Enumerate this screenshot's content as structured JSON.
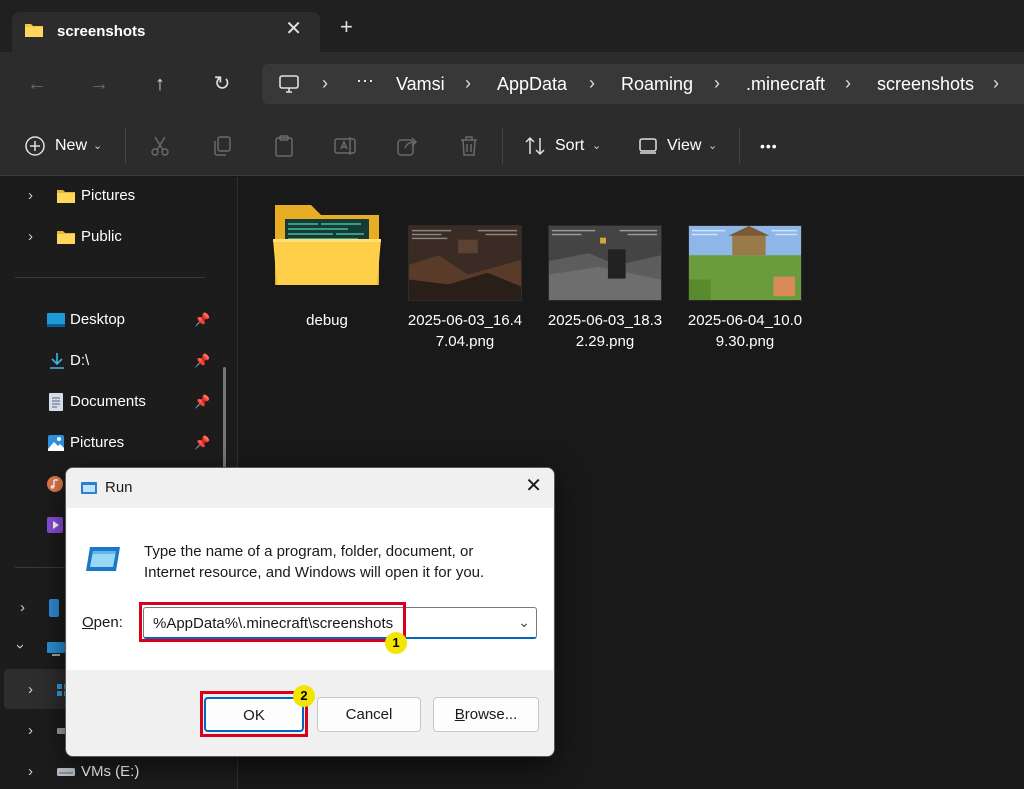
{
  "window": {
    "tab_title": "screenshots",
    "tab_close": "✕",
    "new_tab": "+"
  },
  "address": {
    "back": "←",
    "forward": "→",
    "up": "↑",
    "refresh": "↻",
    "more": "···",
    "breadcrumbs": [
      "Vamsi",
      "AppData",
      "Roaming",
      ".minecraft",
      "screenshots"
    ],
    "separator": "›"
  },
  "toolbar": {
    "new_label": "New",
    "sort_label": "Sort",
    "view_label": "View",
    "more": "•••"
  },
  "sidebar": {
    "items": [
      {
        "label": "Pictures",
        "icon": "folder-icon"
      },
      {
        "label": "Public",
        "icon": "folder-icon"
      },
      {
        "label": "Desktop",
        "icon": "desktop-icon"
      },
      {
        "label": "D:\\",
        "icon": "download-icon"
      },
      {
        "label": "Documents",
        "icon": "documents-icon"
      },
      {
        "label": "Pictures",
        "icon": "pictures-icon"
      },
      {
        "label": "VMs (E:)",
        "icon": "drive-icon"
      }
    ]
  },
  "files": [
    {
      "name": "debug",
      "type": "folder"
    },
    {
      "name": "2025-06-03_16.47.04.png",
      "line1": "2025-06-03_16.4",
      "line2": "7.04.png",
      "type": "image"
    },
    {
      "name": "2025-06-03_18.32.29.png",
      "line1": "2025-06-03_18.3",
      "line2": "2.29.png",
      "type": "image"
    },
    {
      "name": "2025-06-04_10.09.30.png",
      "line1": "2025-06-04_10.0",
      "line2": "9.30.png",
      "type": "image"
    }
  ],
  "run_dialog": {
    "title": "Run",
    "close": "✕",
    "description": "Type the name of a program, folder, document, or Internet resource, and Windows will open it for you.",
    "open_label_u": "O",
    "open_label_rest": "pen:",
    "open_value": "%AppData%\\.minecraft\\screenshots",
    "ok_label": "OK",
    "cancel_label": "Cancel",
    "browse_label_u": "B",
    "browse_label_rest": "rowse...",
    "badges": [
      "1",
      "2"
    ],
    "highlight_color": "#d9001b"
  }
}
